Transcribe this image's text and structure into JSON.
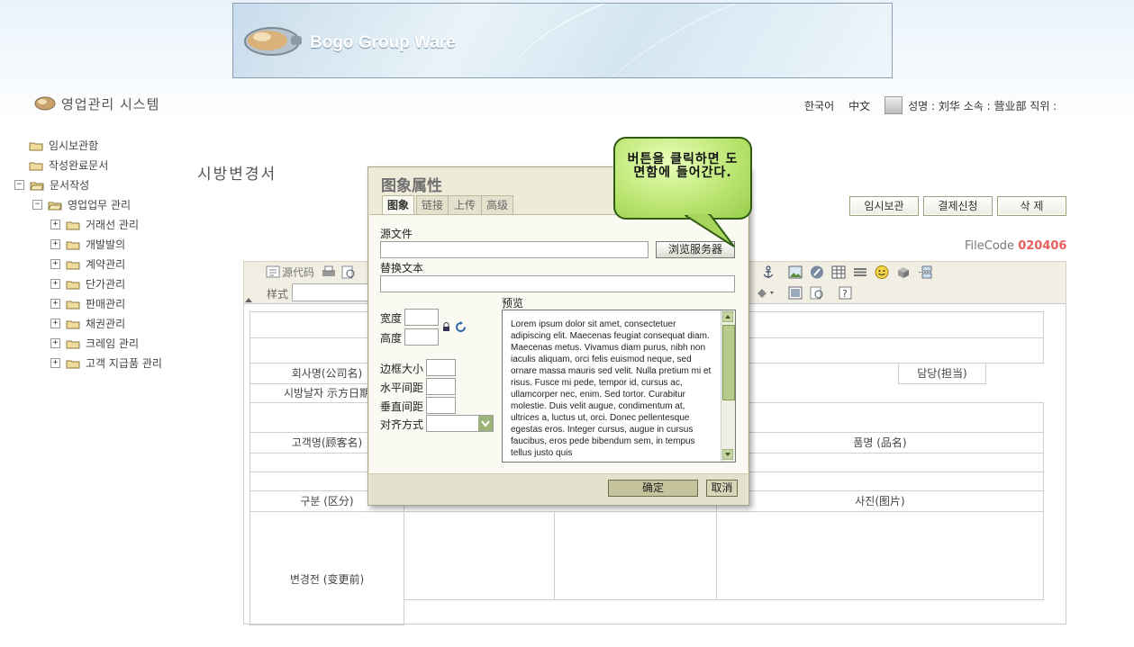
{
  "header": {
    "banner_title": "Bogo Group Ware",
    "system_title": "영업관리 시스템",
    "lang_korean": "한국어",
    "lang_chinese": "中文",
    "user_info": "성명 : 刘华 소속 : 营业部 직위 :"
  },
  "sidebar": {
    "items": [
      {
        "label": "임시보관함"
      },
      {
        "label": "작성완료문서"
      },
      {
        "label": "문서작성",
        "expander": "−"
      },
      {
        "label": "영업업무 관리",
        "expander": "−"
      },
      {
        "label": "거래선 관리",
        "expander": "+"
      },
      {
        "label": "개발발의",
        "expander": "+"
      },
      {
        "label": "계약관리",
        "expander": "+"
      },
      {
        "label": "단가관리",
        "expander": "+"
      },
      {
        "label": "판매관리",
        "expander": "+"
      },
      {
        "label": "채권관리",
        "expander": "+"
      },
      {
        "label": "크레임 관리",
        "expander": "+"
      },
      {
        "label": "고객 지급품 관리",
        "expander": "+"
      }
    ]
  },
  "main": {
    "doc_title": "시방변경서",
    "actions": {
      "temp_save": "임시보관",
      "approval": "결제신청",
      "delete": "삭    제"
    },
    "filecode_label": "FileCode",
    "filecode_value": "020406"
  },
  "editor": {
    "source_label": "源代码",
    "style_label": "样式"
  },
  "doc_table": {
    "company": "회사명(公司名)",
    "manager": "담당(担当)",
    "date": "시방날자 示方日期",
    "customer": "고객명(顾客名)",
    "product": "품명 (品名)",
    "category": "구분 (区分)",
    "photo": "사진(图片)",
    "before": "변경전 (变更前)"
  },
  "dialog": {
    "title": "图象属性",
    "tabs": [
      "图象",
      "链接",
      "上传",
      "高级"
    ],
    "source_file_label": "源文件",
    "source_file_value": "",
    "browse_button": "浏览服务器",
    "alt_text_label": "替换文本",
    "preview_label": "预览",
    "width_label": "宽度",
    "height_label": "高度",
    "border_label": "边框大小",
    "hspace_label": "水平间距",
    "vspace_label": "垂直间距",
    "align_label": "对齐方式",
    "preview_text": "Lorem ipsum dolor sit amet, consectetuer adipiscing elit. Maecenas feugiat consequat diam. Maecenas metus. Vivamus diam purus, nibh non iaculis aliquam, orci felis euismod neque, sed ornare massa mauris sed velit. Nulla pretium mi et risus. Fusce mi pede, tempor id, cursus ac, ullamcorper nec, enim. Sed tortor. Curabitur molestie. Duis velit augue, condimentum at, ultrices a, luctus ut, orci. Donec pellentesque egestas eros. Integer cursus, augue in cursus faucibus, eros pede bibendum sem, in tempus tellus justo quis",
    "ok_button": "确定",
    "cancel_button": "取消"
  },
  "tooltip": {
    "text": "버튼을 클릭하면 도면함에 들어간다."
  },
  "colors": {
    "filecode_accent": "#e8605c",
    "tooltip_fill": "#b8e46e",
    "dialog_bg": "#eeecd9"
  }
}
